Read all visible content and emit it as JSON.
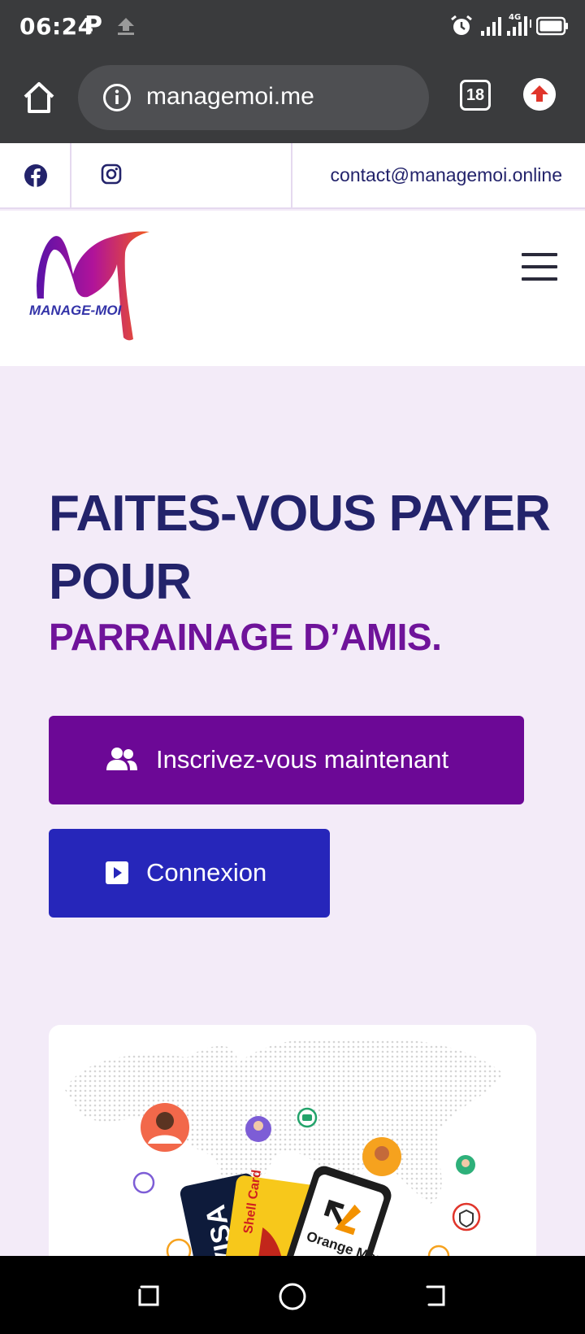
{
  "status_bar": {
    "time": "06:24",
    "carrier_icon": "P",
    "network_label": "4G",
    "icons": [
      "upload-icon",
      "alarm-icon",
      "signal-icon",
      "signal-4g-icon",
      "battery-icon"
    ]
  },
  "browser": {
    "url": "managemoi.me",
    "tab_count": "18",
    "icons": [
      "home-icon",
      "info-icon",
      "update-icon"
    ]
  },
  "topbar": {
    "contact_email": "contact@managemoi.online",
    "social": [
      "facebook-icon",
      "instagram-icon"
    ]
  },
  "logo": {
    "wordmark": "MANAGE-MOI"
  },
  "hero": {
    "title": "FAITES-VOUS PAYER POUR",
    "subtitle": "PARRAINAGE D’AMIS.",
    "signup_label": "Inscrivez-vous maintenant",
    "login_label": "Connexion"
  },
  "illustration": {
    "card_labels": [
      "VISA",
      "Shell Card",
      "Orange Money"
    ]
  },
  "colors": {
    "navy": "#23236b",
    "purple": "#6f139a",
    "signup_bg": "#6c0896",
    "login_bg": "#2626ba",
    "page_bg": "#f3ebf8",
    "browser_chrome": "#3a3b3d"
  }
}
